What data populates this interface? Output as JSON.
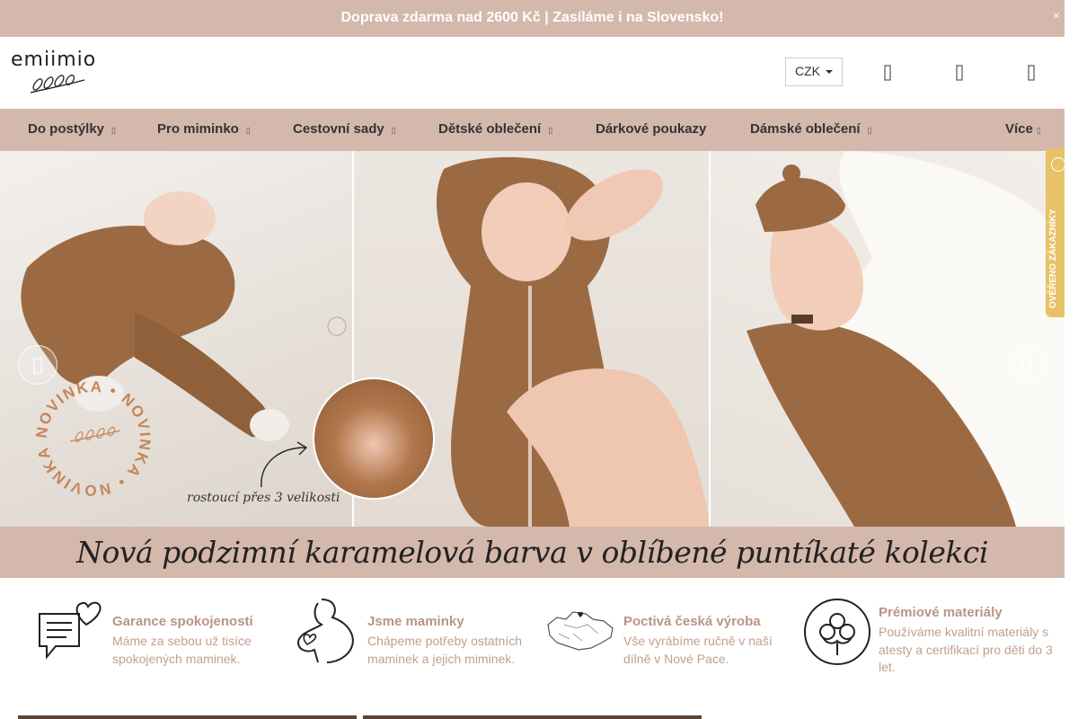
{
  "topbar": {
    "text": "Doprava zdarma nad 2600 Kč | Zasíláme i na Slovensko!",
    "close_icon": "close-icon"
  },
  "header": {
    "logo_text": "emiimio",
    "currency": "CZK",
    "icons": [
      "search-icon",
      "user-icon",
      "cart-icon"
    ]
  },
  "nav": {
    "items": [
      {
        "label": "Do postýlky",
        "has_submenu": true
      },
      {
        "label": "Pro miminko",
        "has_submenu": true
      },
      {
        "label": "Cestovní sady",
        "has_submenu": true
      },
      {
        "label": "Dětské oblečení",
        "has_submenu": true
      },
      {
        "label": "Dárkové poukazy",
        "has_submenu": false
      },
      {
        "label": "Dámské oblečení",
        "has_submenu": true
      },
      {
        "label": "Více",
        "has_submenu": true
      }
    ]
  },
  "hero": {
    "badge_text": "NOVINKA",
    "caption": "rostoucí přes 3 velikosti",
    "prev_icon": "chevron-left-icon",
    "next_icon": "chevron-right-icon"
  },
  "review_tab": {
    "label": "OVĚŘENO ZÁKAZNÍKY"
  },
  "banner": {
    "text": "Nová podzimní karamelová barva v oblíbené puntíkaté kolekci"
  },
  "features": [
    {
      "icon": "chat-heart-icon",
      "title": "Garance spokojenosti",
      "desc": "Máme za sebou už tisíce spokojených maminek."
    },
    {
      "icon": "pregnant-mother-icon",
      "title": "Jsme maminky",
      "desc": "Chápeme potřeby ostatních maminek a jejich miminek."
    },
    {
      "icon": "czech-map-icon",
      "title": "Poctivá česká výroba",
      "desc": "Vše vyrábíme ručně v naší dílně v Nové Pace."
    },
    {
      "icon": "cotton-icon",
      "title": "Prémiové materiály",
      "desc": "Používáme kvalitní materiály s atesty a certifikací pro děti do 3 let."
    }
  ],
  "colors": {
    "accent": "#d4b8ac",
    "feature_title": "#b99583",
    "feature_desc": "#c0a08f",
    "badge": "#c4865a"
  }
}
